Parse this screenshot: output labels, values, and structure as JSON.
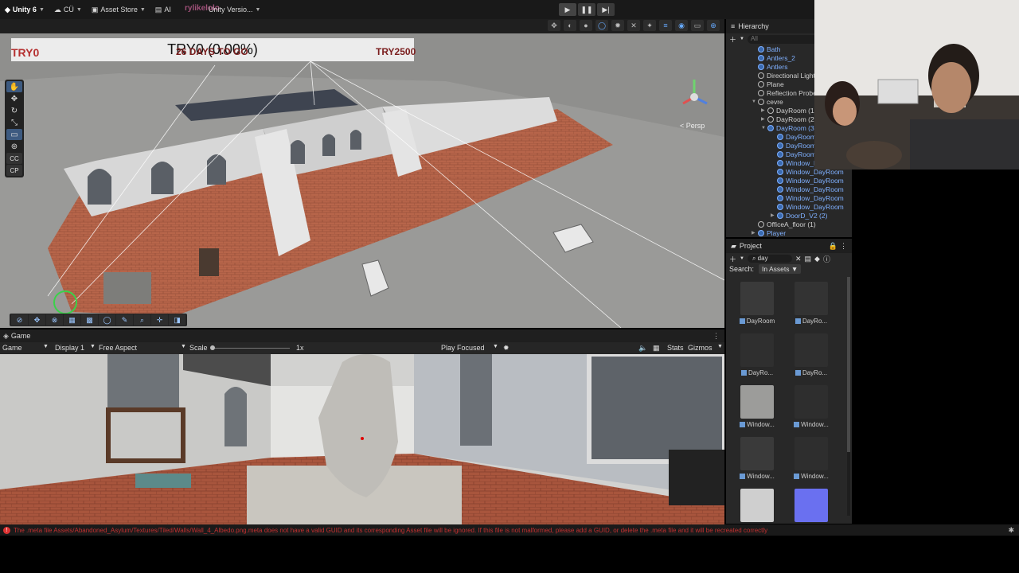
{
  "toolbar": {
    "app_label": "Unity 6",
    "account_label": "CÜ",
    "asset_store_label": "Asset Store",
    "ai_label": "AI",
    "ghost_text": "rylikelolo",
    "version_label": "Unity Versio..."
  },
  "scene": {
    "banner": "TRY0 (0.00%)",
    "overlay_left": "TRY0",
    "overlay_center": "26 DAYS TO GO",
    "overlay_right": "TRY2500",
    "persp_label": "< Persp",
    "tool_cc": "CC",
    "tool_cp": "CP"
  },
  "game": {
    "tab_label": "Game",
    "mode_dropdown": "Game",
    "display_dropdown": "Display 1",
    "aspect_dropdown": "Free Aspect",
    "scale_label": "Scale",
    "scale_value": "1x",
    "play_focused": "Play Focused",
    "stats_label": "Stats",
    "gizmos_label": "Gizmos"
  },
  "hierarchy": {
    "tab_label": "Hierarchy",
    "search_placeholder": "All",
    "items": [
      {
        "label": "Bath",
        "blue": true
      },
      {
        "label": "Antlers_2",
        "blue": true
      },
      {
        "label": "Antlers",
        "blue": true
      },
      {
        "label": "Directional Light",
        "blue": false
      },
      {
        "label": "Plane",
        "blue": false
      },
      {
        "label": "Reflection Probe",
        "blue": false
      },
      {
        "label": "cevre",
        "blue": false
      },
      {
        "label": "DayRoom (1)",
        "blue": false
      },
      {
        "label": "DayRoom (2)",
        "blue": false
      },
      {
        "label": "DayRoom (3)",
        "blue": true
      },
      {
        "label": "DayRoom",
        "blue": true
      },
      {
        "label": "DayRoom",
        "blue": true
      },
      {
        "label": "DayRoom",
        "blue": true
      },
      {
        "label": "Window_Day",
        "blue": true
      },
      {
        "label": "Window_DayRoom",
        "blue": true
      },
      {
        "label": "Window_DayRoom",
        "blue": true
      },
      {
        "label": "Window_DayRoom",
        "blue": true
      },
      {
        "label": "Window_DayRoom",
        "blue": true
      },
      {
        "label": "Window_DayRoom",
        "blue": true
      },
      {
        "label": "DoorD_V2 (2)",
        "blue": true
      },
      {
        "label": "OfficeA_floor (1)",
        "blue": false
      },
      {
        "label": "Player",
        "blue": true
      }
    ]
  },
  "project": {
    "tab_label": "Project",
    "search_text": "day",
    "search_label": "Search:",
    "scope_chip": "In Assets",
    "assets": [
      {
        "label": "DayRoom"
      },
      {
        "label": "DayRo..."
      },
      {
        "label": "DayRo..."
      },
      {
        "label": "DayRo..."
      },
      {
        "label": "Window..."
      },
      {
        "label": "Window..."
      },
      {
        "label": "Window..."
      },
      {
        "label": "Window..."
      },
      {
        "label": ""
      },
      {
        "label": ""
      }
    ]
  },
  "status": {
    "error": "The .meta file Assets/Abandoned_Asylum/Textures/Tiled/Walls/Wall_4_Albedo.png.meta does not have a valid GUID and its corresponding Asset file will be ignored. If this file is not malformed, please add a GUID, or delete the .meta file and it will be recreated correctly"
  },
  "colors": {
    "accent_blue": "#7fb0ff",
    "error_red": "#c23030",
    "overlay_red": "#7a1d1d"
  }
}
